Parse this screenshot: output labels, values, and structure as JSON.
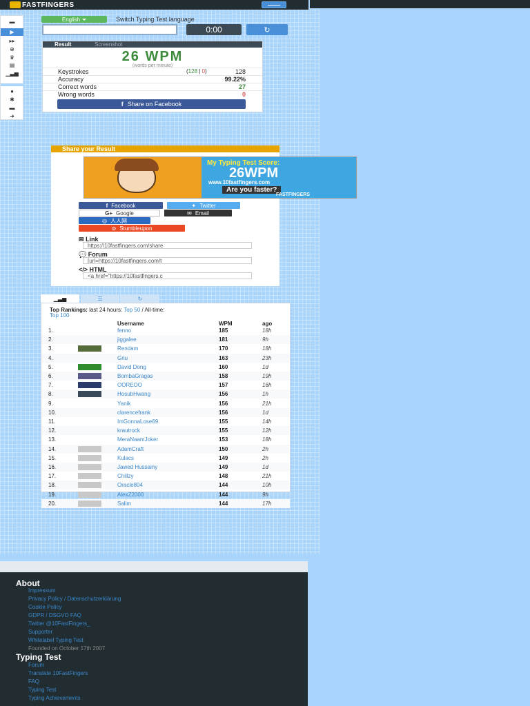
{
  "navbar": {
    "logo_text": "FASTFINGERS"
  },
  "sidebar": {
    "items": [
      "keyboard-icon",
      "play-icon",
      "gamepad-icon",
      "trophy-icon",
      "book-icon",
      "bar-chart-icon",
      "user-icon",
      "gear-icon",
      "minus-icon",
      "sign-in-icon"
    ]
  },
  "controls": {
    "language_button": "English",
    "switch_text": "Switch Typing Test language",
    "input_value": "",
    "timer": "0:00",
    "reload_icon": "↻"
  },
  "result": {
    "tab_result": "Result",
    "tab_screenshot": "Screenshot",
    "wpm": "26 WPM",
    "wpm_sub": "(words per minute)",
    "stats": [
      {
        "label": "Keystrokes",
        "correct": "128",
        "sep": "|",
        "wrong": "0",
        "value": "128"
      },
      {
        "label": "Accuracy",
        "value": "99.22%"
      },
      {
        "label": "Correct words",
        "value": "27"
      },
      {
        "label": "Wrong words",
        "value": "0"
      }
    ],
    "share_facebook": "Share on Facebook"
  },
  "share": {
    "header": "Share your Result",
    "banner": {
      "line1": "My Typing Test Score:",
      "score": "26WPM",
      "url": "www.10fastfingers.com",
      "question": "Are you faster?",
      "logo": "FASTFINGERS"
    },
    "buttons": {
      "facebook": "Facebook",
      "twitter": "Twitter",
      "google": "Google",
      "email": "Email",
      "renren": "人人网",
      "stumbleupon": "Stumbleupon"
    },
    "link_label": "Link",
    "link_value": "https://10fastfingers.com/share",
    "forum_label": "Forum",
    "forum_value": "[url=https://10fastfingers.com/t",
    "html_label": "HTML",
    "html_value": "<a href=\"https://10fastfingers.c"
  },
  "rankings": {
    "tabs": [
      "bar-chart-icon",
      "list-icon",
      "refresh-icon"
    ],
    "title_prefix": "Top Rankings:",
    "title_mid": " last 24 hours: ",
    "top50": "Top 50",
    "all_time": " / All-time:",
    "top100": "Top 100",
    "headers": {
      "username": "Username",
      "wpm": "WPM",
      "ago": "ago"
    },
    "rows": [
      {
        "pos": "1.",
        "user": "fenno",
        "wpm": "185",
        "ago": "18h",
        "flag": ""
      },
      {
        "pos": "2.",
        "user": "jiggalee",
        "wpm": "181",
        "ago": "9h",
        "flag": ""
      },
      {
        "pos": "3.",
        "user": "Rendam",
        "wpm": "170",
        "ago": "18h",
        "flag": "#556b3a"
      },
      {
        "pos": "4.",
        "user": "Griu",
        "wpm": "163",
        "ago": "23h",
        "flag": ""
      },
      {
        "pos": "5.",
        "user": "David Dong",
        "wpm": "160",
        "ago": "1d",
        "flag": "#2e8b2e"
      },
      {
        "pos": "6.",
        "user": "BombaGragas",
        "wpm": "158",
        "ago": "19h",
        "flag": "#5a5a8a"
      },
      {
        "pos": "7.",
        "user": "OOREOO",
        "wpm": "157",
        "ago": "16h",
        "flag": "#2a3a6a"
      },
      {
        "pos": "8.",
        "user": "HosubHwang",
        "wpm": "156",
        "ago": "1h",
        "flag": "#3a4a5a"
      },
      {
        "pos": "9.",
        "user": "Yanik",
        "wpm": "156",
        "ago": "21h",
        "flag": ""
      },
      {
        "pos": "10.",
        "user": "clarencefrank",
        "wpm": "156",
        "ago": "1d",
        "flag": ""
      },
      {
        "pos": "11.",
        "user": "ImGonnaLose69",
        "wpm": "155",
        "ago": "14h",
        "flag": ""
      },
      {
        "pos": "12.",
        "user": "krautrock",
        "wpm": "155",
        "ago": "12h",
        "flag": ""
      },
      {
        "pos": "13.",
        "user": "MeraNaamJoker",
        "wpm": "153",
        "ago": "18h",
        "flag": ""
      },
      {
        "pos": "14.",
        "user": "AdamCraft",
        "wpm": "150",
        "ago": "2h",
        "flag": "#c8c8c8"
      },
      {
        "pos": "15.",
        "user": "Kulacs",
        "wpm": "149",
        "ago": "2h",
        "flag": "#c8c8c8"
      },
      {
        "pos": "16.",
        "user": "Jawed Hussainy",
        "wpm": "149",
        "ago": "1d",
        "flag": "#c8c8c8"
      },
      {
        "pos": "17.",
        "user": "Chillzy",
        "wpm": "148",
        "ago": "21h",
        "flag": "#c8c8c8"
      },
      {
        "pos": "18.",
        "user": "Oracle804",
        "wpm": "144",
        "ago": "10h",
        "flag": "#c8c8c8"
      },
      {
        "pos": "19.",
        "user": "AlexZ2000",
        "wpm": "144",
        "ago": "9h",
        "flag": "#c8c8c8"
      },
      {
        "pos": "20.",
        "user": "Salim",
        "wpm": "144",
        "ago": "17h",
        "flag": "#c8c8c8"
      }
    ]
  },
  "footer": {
    "about_title": "About",
    "about_links": [
      "Impressum",
      "Privacy Policy / Datenschutzerklärung",
      "Cookie Policy",
      "GDPR / DSGVO FAQ",
      "Twitter @10FastFingers_",
      "Supporter",
      "Whitelabel Typing Test"
    ],
    "founded": "Founded on October 17th 2007",
    "typing_title": "Typing Test",
    "typing_links": [
      "Forum",
      "Translate 10FastFingers",
      "FAQ",
      "Typing Test",
      "Typing Achievements"
    ]
  },
  "colors": {
    "accent": "#4a90d9",
    "success": "#5cb85c",
    "danger": "#d9534f",
    "facebook": "#3b5998",
    "twitter": "#55acee",
    "warning": "#e6a400",
    "navbar": "#222d32",
    "background": "#a9d4fb"
  }
}
